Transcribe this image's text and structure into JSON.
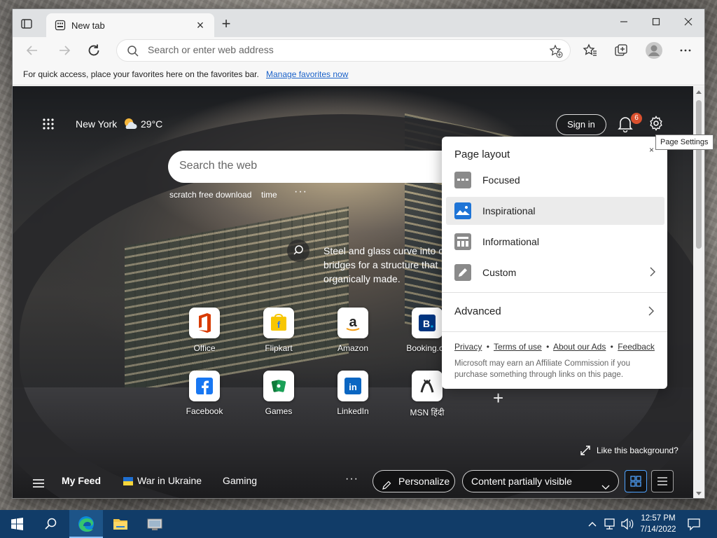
{
  "browser": {
    "tab_title": "New tab",
    "address_placeholder": "Search or enter web address",
    "favbar_text": "For quick access, place your favorites here on the favorites bar.",
    "favbar_link": "Manage favorites now"
  },
  "ntp": {
    "weather_city": "New York",
    "weather_temp": "29°C",
    "sign_in": "Sign in",
    "notification_count": "6",
    "search_placeholder": "Search the web",
    "trending": [
      "scratch free download",
      "time"
    ],
    "more_glyph": "···",
    "background_info": "Steel and glass curve into c bridges for a structure that organically made.",
    "like_background": "Like this background?",
    "tiles": [
      {
        "label": "Office",
        "icon": "office-icon",
        "color": "#d83b01"
      },
      {
        "label": "Flipkart",
        "icon": "flipkart-icon",
        "color": "#f7c600"
      },
      {
        "label": "Amazon",
        "icon": "amazon-icon",
        "color": "#222222"
      },
      {
        "label": "Booking.co",
        "icon": "booking-icon",
        "color": "#003580"
      },
      {
        "label": "Facebook",
        "icon": "facebook-icon",
        "color": "#1877f2"
      },
      {
        "label": "Games",
        "icon": "games-icon",
        "color": "#0f7b3a"
      },
      {
        "label": "LinkedIn",
        "icon": "linkedin-icon",
        "color": "#0a66c2"
      },
      {
        "label": "MSN हिंदी",
        "icon": "msn-icon",
        "color": "#2b2b2b"
      }
    ]
  },
  "feedbar": {
    "my_feed": "My Feed",
    "items": [
      "War in Ukraine",
      "Gaming"
    ],
    "personalize": "Personalize",
    "visibility": "Content partially visible"
  },
  "page_layout": {
    "title": "Page layout",
    "close_glyph": "×",
    "options": [
      {
        "label": "Focused",
        "selected": false
      },
      {
        "label": "Inspirational",
        "selected": true
      },
      {
        "label": "Informational",
        "selected": false
      },
      {
        "label": "Custom",
        "selected": false
      }
    ],
    "advanced": "Advanced",
    "links": [
      "Privacy",
      "Terms of use",
      "About our Ads",
      "Feedback"
    ],
    "link_separator": "•",
    "affiliate_note": "Microsoft may earn an Affiliate Commission if you purchase something through links on this page."
  },
  "tooltip": "Page Settings",
  "taskbar": {
    "time": "12:57 PM",
    "date": "7/14/2022"
  },
  "colors": {
    "accent": "#0067c0",
    "taskbar": "#113c68",
    "badge": "#d9502e"
  }
}
